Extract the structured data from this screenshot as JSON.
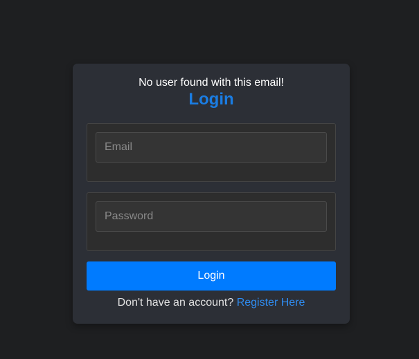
{
  "login_form": {
    "error_message": "No user found with this email!",
    "title": "Login",
    "email": {
      "placeholder": "Email",
      "value": ""
    },
    "password": {
      "placeholder": "Password",
      "value": ""
    },
    "submit_label": "Login",
    "register_prompt": "Don't have an account?",
    "register_link_label": "Register Here"
  },
  "colors": {
    "page_background": "#1e1f21",
    "card_background": "#2c2f36",
    "accent": "#007bff",
    "title": "#1a7de3",
    "link": "#2f8cf0",
    "error_text": "#ffffff"
  }
}
